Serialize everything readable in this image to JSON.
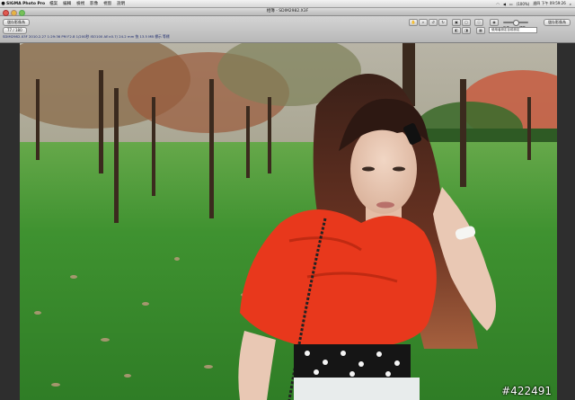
{
  "menubar": {
    "app_name": "SIGMA Photo Pro",
    "menus": [
      "檔案",
      "編輯",
      "檢視",
      "影像",
      "視窗",
      "說明"
    ],
    "status": {
      "battery": "(100%)",
      "clock": "週四 下午 09:59:26"
    }
  },
  "window": {
    "title": "相簿 - SDIM2982.X3F"
  },
  "toolbar": {
    "left_button": "儲存影像為",
    "filmstrip_counter": "77 / 180",
    "right_button": "儲存影像為",
    "preset_select": "使用者設定目前設定",
    "slider_labels": [
      "影像",
      "標準"
    ]
  },
  "file_info": "SDIM2982.X3F 2010.2.27 1:29:36 PM F2.8 1/200秒 ISO100 AE±0.7/ 24.2 mm 快 13.5 MB 標示 等標",
  "photo": {
    "watermark": "#422491"
  },
  "colors": {
    "sweater": "#e8381c",
    "grass": "#3d8f2f",
    "app_accent": "#1c2a6e"
  }
}
